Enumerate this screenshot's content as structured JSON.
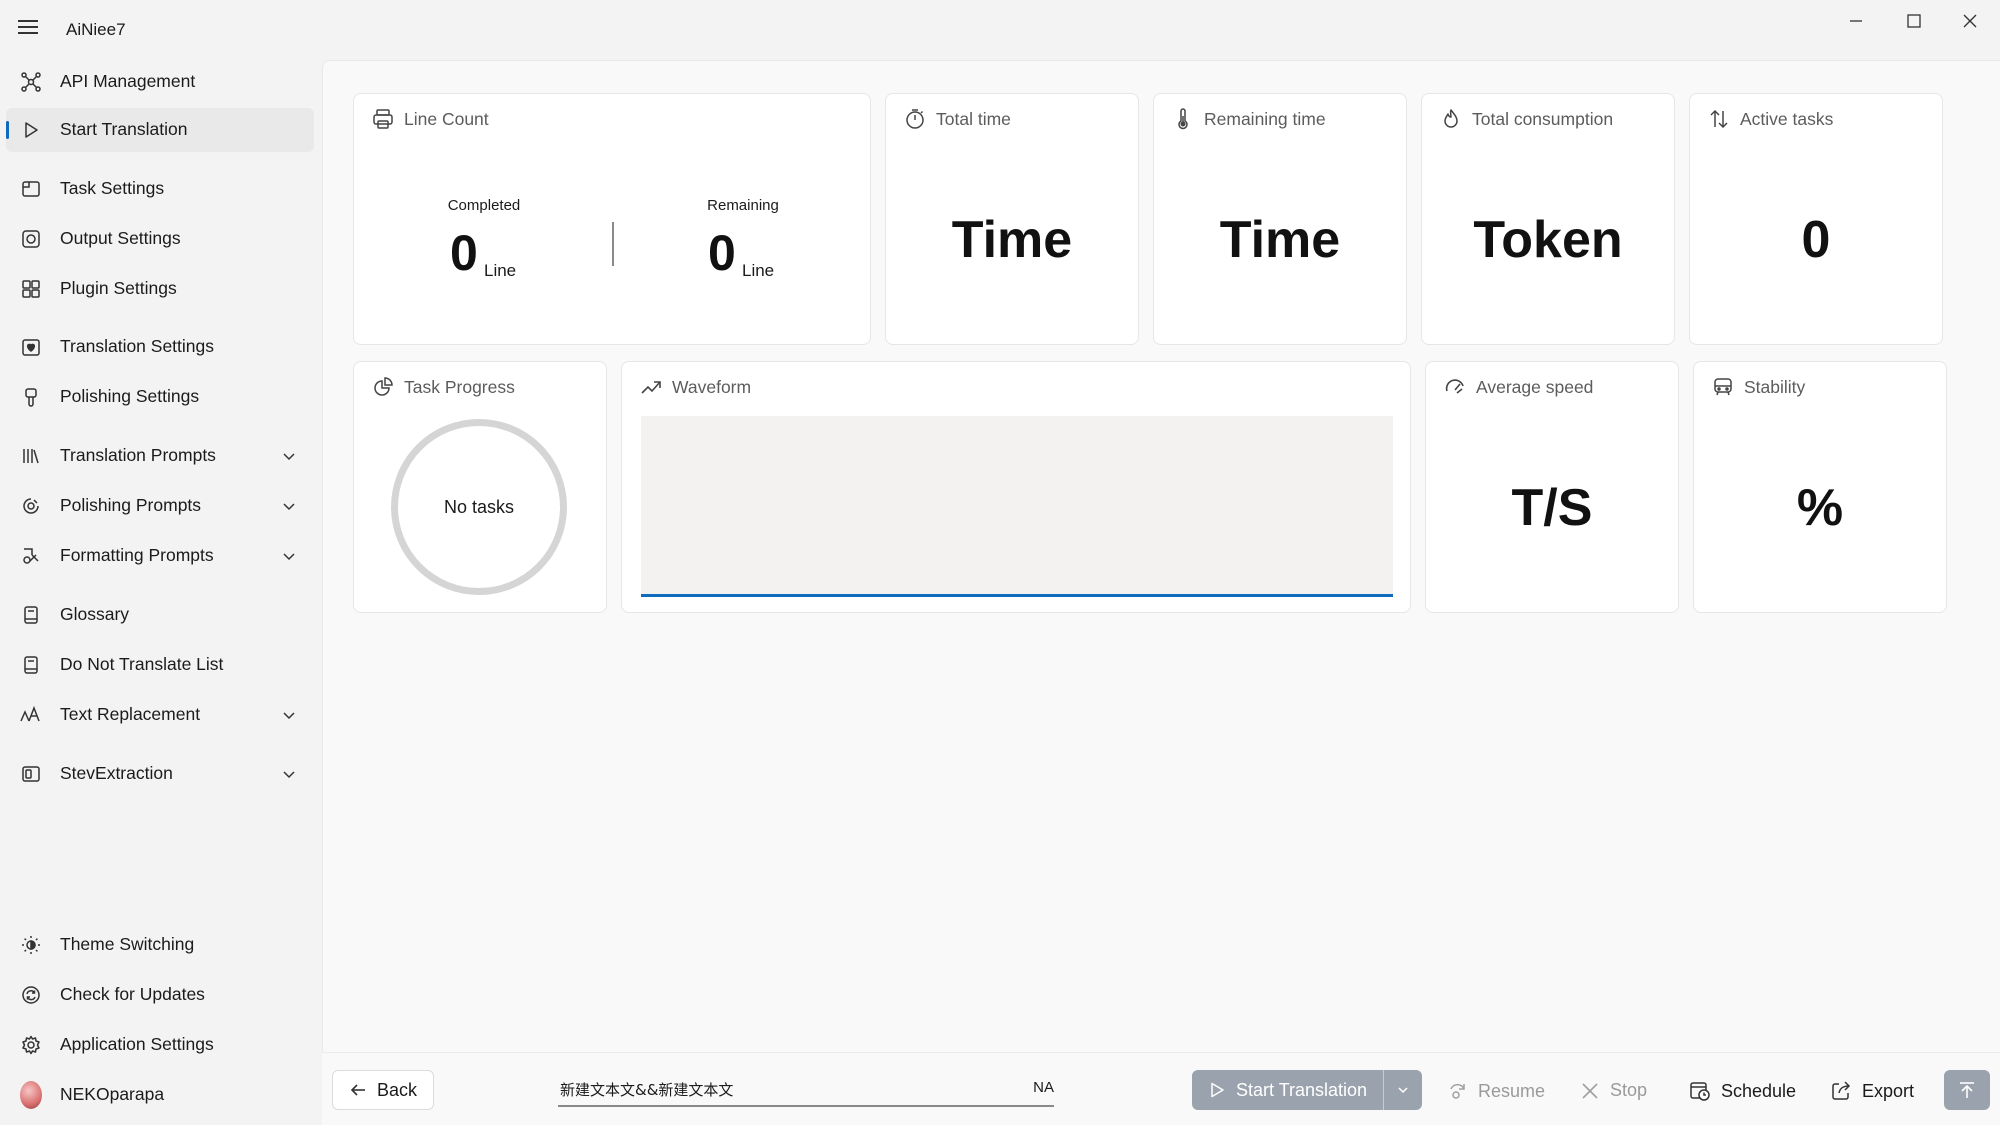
{
  "app": {
    "title": "AiNiee7",
    "window_controls": [
      "minimize-icon",
      "maximize-icon",
      "close-icon"
    ]
  },
  "sidebar": {
    "items": [
      {
        "label": "API Management",
        "icon": "api-icon",
        "active": false,
        "expandable": false
      },
      {
        "label": "Start Translation",
        "icon": "play-icon",
        "active": true,
        "expandable": false
      },
      {
        "label": "Task Settings",
        "icon": "task-settings-icon",
        "active": false,
        "expandable": false
      },
      {
        "label": "Output Settings",
        "icon": "output-icon",
        "active": false,
        "expandable": false
      },
      {
        "label": "Plugin Settings",
        "icon": "plugin-icon",
        "active": false,
        "expandable": false
      },
      {
        "label": "Translation Settings",
        "icon": "translation-settings-icon",
        "active": false,
        "expandable": false
      },
      {
        "label": "Polishing Settings",
        "icon": "brush-icon",
        "active": false,
        "expandable": false
      },
      {
        "label": "Translation Prompts",
        "icon": "library-icon",
        "active": false,
        "expandable": true
      },
      {
        "label": "Polishing Prompts",
        "icon": "polish-prompt-icon",
        "active": false,
        "expandable": true
      },
      {
        "label": "Formatting Prompts",
        "icon": "format-icon",
        "active": false,
        "expandable": true
      },
      {
        "label": "Glossary",
        "icon": "book-icon",
        "active": false,
        "expandable": false
      },
      {
        "label": "Do Not Translate List",
        "icon": "book-icon",
        "active": false,
        "expandable": false
      },
      {
        "label": "Text Replacement",
        "icon": "font-size-icon",
        "active": false,
        "expandable": true
      },
      {
        "label": "StevExtraction",
        "icon": "extraction-icon",
        "active": false,
        "expandable": true
      }
    ],
    "footer": [
      {
        "label": "Theme Switching",
        "icon": "brightness-icon"
      },
      {
        "label": "Check for Updates",
        "icon": "sync-icon"
      },
      {
        "label": "Application Settings",
        "icon": "gear-icon"
      },
      {
        "label": "NEKOparapa",
        "icon": "avatar"
      }
    ]
  },
  "dashboard": {
    "line_count": {
      "title": "Line Count",
      "completed_label": "Completed",
      "completed_value": "0",
      "remaining_label": "Remaining",
      "remaining_value": "0",
      "unit": "Line"
    },
    "total_time": {
      "title": "Total time",
      "value": "Time"
    },
    "remaining_time": {
      "title": "Remaining time",
      "value": "Time"
    },
    "total_consumption": {
      "title": "Total consumption",
      "value": "Token"
    },
    "active_tasks": {
      "title": "Active tasks",
      "value": "0"
    },
    "task_progress": {
      "title": "Task Progress",
      "status": "No tasks"
    },
    "waveform": {
      "title": "Waveform"
    },
    "average_speed": {
      "title": "Average speed",
      "value": "T/S"
    },
    "stability": {
      "title": "Stability",
      "value": "%"
    }
  },
  "command_bar": {
    "back_label": "Back",
    "file_name": "新建文本文&&新建文本文",
    "file_status": "NA",
    "start_label": "Start Translation",
    "resume_label": "Resume",
    "stop_label": "Stop",
    "schedule_label": "Schedule",
    "export_label": "Export"
  },
  "colors": {
    "accent": "#0f6cbd",
    "disabled_button": "#9aa3ad",
    "background": "#f3f3f3"
  }
}
